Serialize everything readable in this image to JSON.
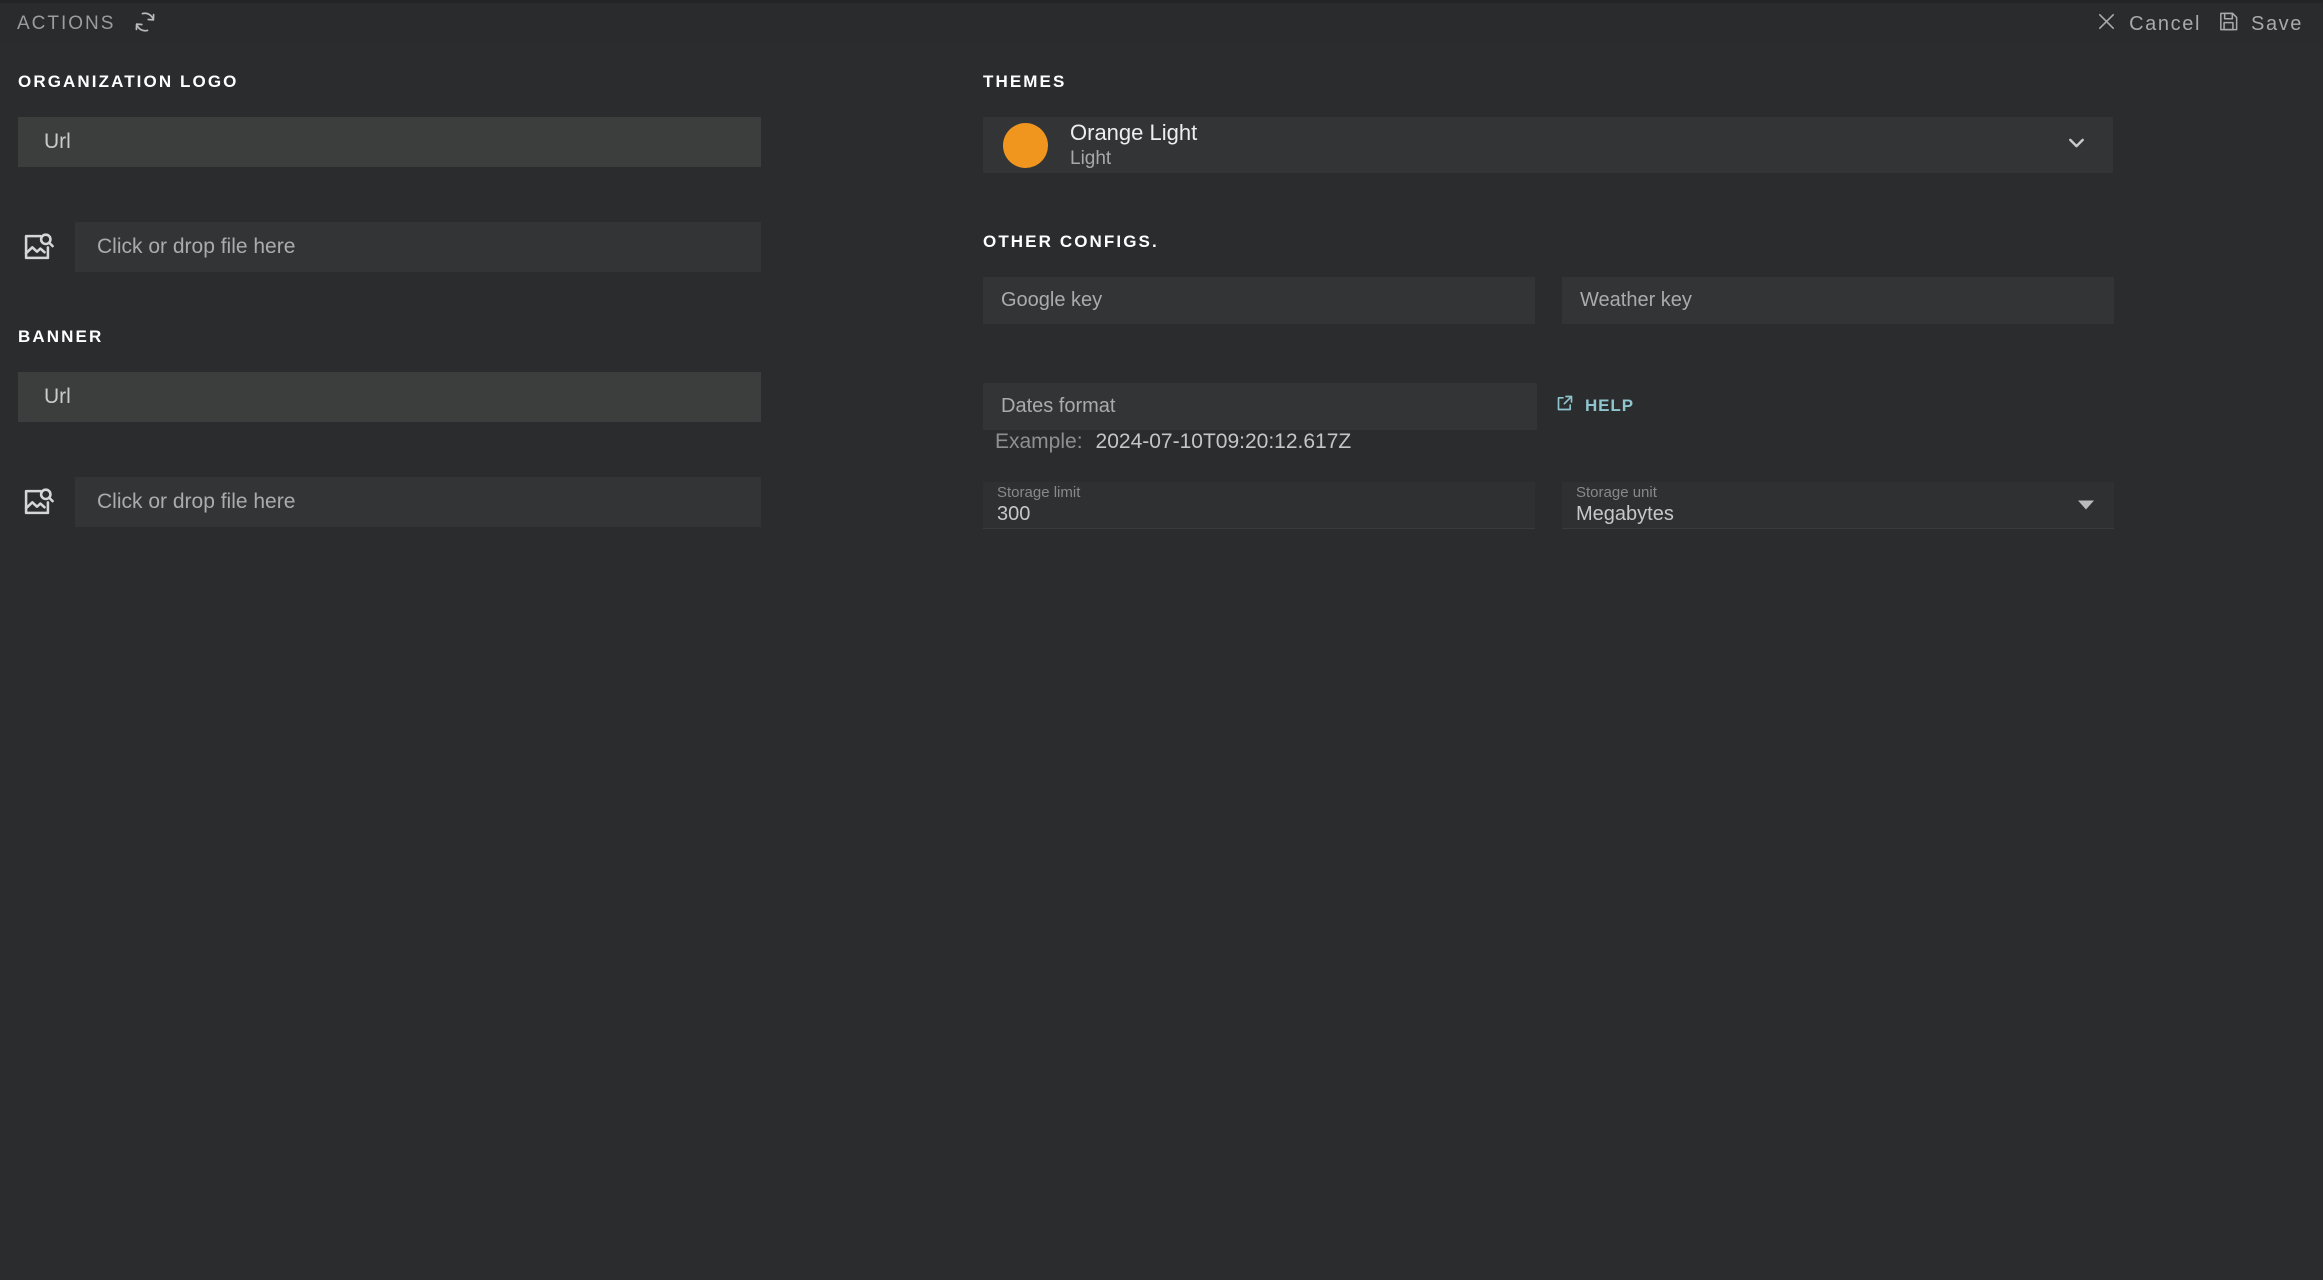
{
  "topbar": {
    "actions_label": "ACTIONS",
    "refresh_icon": "refresh-icon",
    "close_icon": "close-icon",
    "cancel_label": "Cancel",
    "save_icon": "save-floppy-icon",
    "save_label": "Save"
  },
  "left": {
    "logo_section": {
      "title": "ORGANIZATION LOGO",
      "url_placeholder": "Url",
      "url_value": "",
      "file_icon": "image-search-icon",
      "dropzone_placeholder": "Click or drop file here"
    },
    "banner_section": {
      "title": "BANNER",
      "url_placeholder": "Url",
      "url_value": "",
      "file_icon": "image-search-icon",
      "dropzone_placeholder": "Click or drop file here"
    }
  },
  "right": {
    "themes": {
      "title": "THEMES",
      "selected_name": "Orange Light",
      "selected_mode": "Light",
      "swatch_color": "#f0961e",
      "chevron_icon": "chevron-down-icon"
    },
    "other_configs": {
      "title": "OTHER CONFIGS.",
      "google_key_placeholder": "Google key",
      "google_key_value": "",
      "weather_key_placeholder": "Weather key",
      "weather_key_value": "",
      "dates_format_placeholder": "Dates format",
      "dates_format_value": "",
      "help_label": "HELP",
      "help_icon": "external-link-icon",
      "example_label": "Example:",
      "example_value": "2024-07-10T09:20:12.617Z",
      "storage_limit_label": "Storage limit",
      "storage_limit_value": "300",
      "storage_unit_label": "Storage unit",
      "storage_unit_value": "Megabytes",
      "storage_unit_caret": "caret-down-icon"
    }
  },
  "colors": {
    "page_bg": "#2b2c2e",
    "field_bg": "#333436",
    "url_field_bg": "#3c3e3e",
    "accent_orange": "#f0961e",
    "link_blue": "#8ec5ce"
  }
}
